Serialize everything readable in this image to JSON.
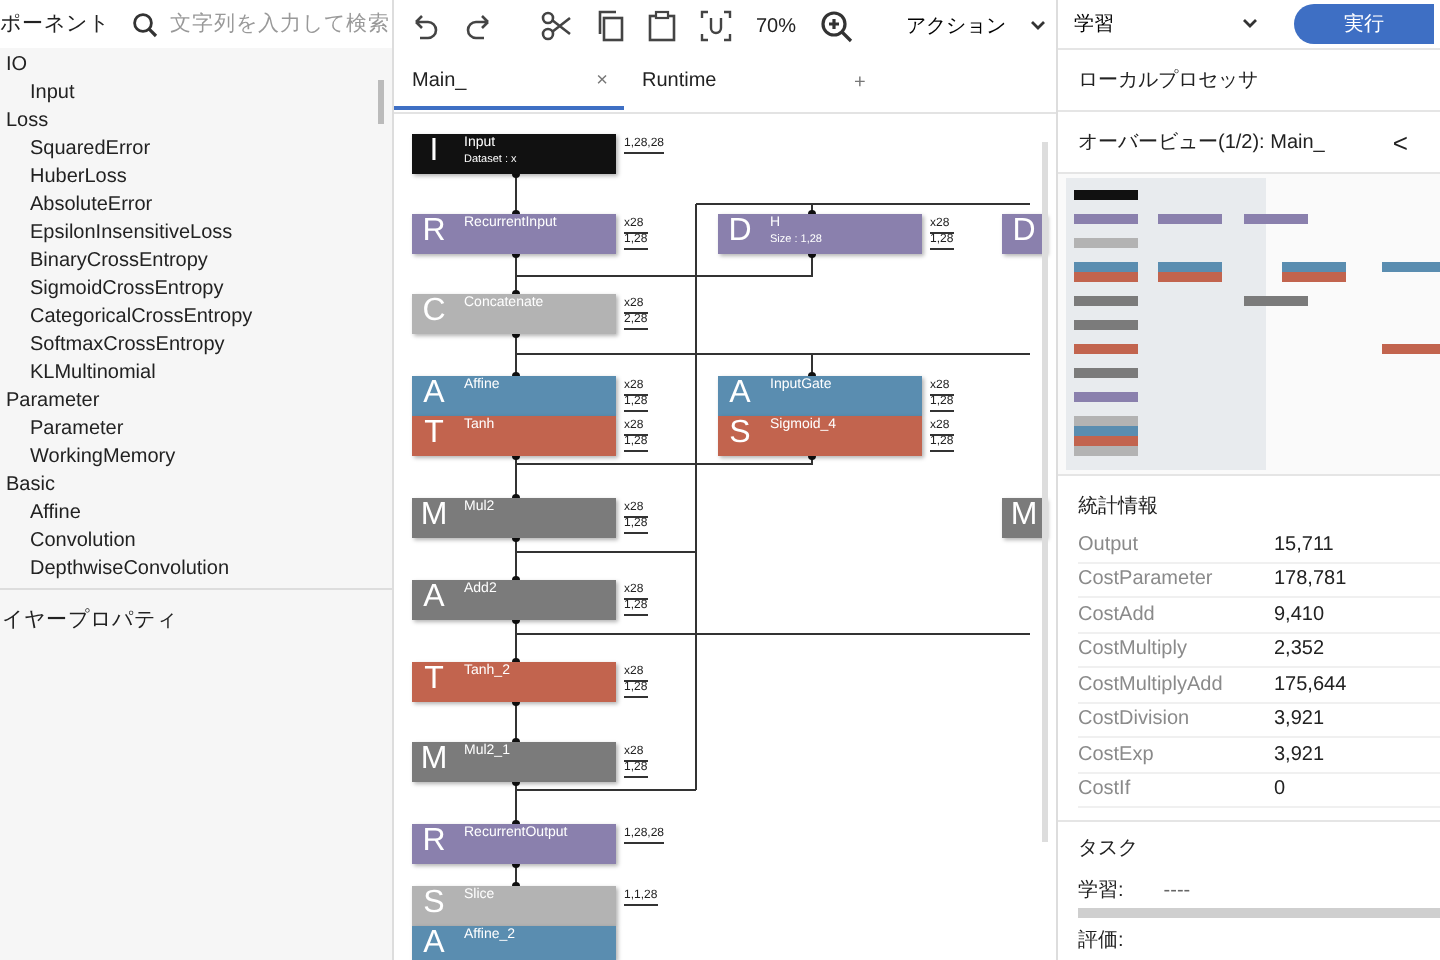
{
  "components": {
    "title": "ポーネント",
    "search_placeholder": "文字列を入力して検索",
    "groups": [
      {
        "label": "IO",
        "children": [
          {
            "label": "Input"
          }
        ]
      },
      {
        "label": "Loss",
        "children": [
          {
            "label": "SquaredError"
          },
          {
            "label": "HuberLoss"
          },
          {
            "label": "AbsoluteError"
          },
          {
            "label": "EpsilonInsensitiveLoss"
          },
          {
            "label": "BinaryCrossEntropy"
          },
          {
            "label": "SigmoidCrossEntropy"
          },
          {
            "label": "CategoricalCrossEntropy"
          },
          {
            "label": "SoftmaxCrossEntropy"
          },
          {
            "label": "KLMultinomial"
          }
        ]
      },
      {
        "label": "Parameter",
        "children": [
          {
            "label": "Parameter"
          },
          {
            "label": "WorkingMemory"
          }
        ]
      },
      {
        "label": "Basic",
        "children": [
          {
            "label": "Affine"
          },
          {
            "label": "Convolution"
          },
          {
            "label": "DepthwiseConvolution"
          }
        ]
      }
    ],
    "properties_title": "イヤープロパティ"
  },
  "toolbar": {
    "zoom": "70%",
    "action_menu": "アクション"
  },
  "tabs": [
    {
      "label": "Main_",
      "selected": true,
      "close": "×"
    },
    {
      "label": "Runtime",
      "selected": false
    }
  ],
  "add_tab": "+",
  "graph": {
    "nodes": [
      {
        "letter": "I",
        "name": "Input",
        "subtitle": "Dataset : x",
        "color": "#111111",
        "side": [
          "1,28,28"
        ]
      },
      {
        "letter": "R",
        "name": "RecurrentInput",
        "color": "#8a80ad",
        "side": [
          "x28",
          "1,28"
        ]
      },
      {
        "letter": "D",
        "name": "H",
        "subtitle": "Size : 1,28",
        "color": "#8a80ad",
        "side": [
          "x28",
          "1,28"
        ]
      },
      {
        "letter": "D",
        "color": "#8a80ad"
      },
      {
        "letter": "C",
        "name": "Concatenate",
        "color": "#b3b3b3",
        "side": [
          "x28",
          "2,28"
        ]
      },
      {
        "letter": "A",
        "name": "Affine",
        "color": "#5a8db0",
        "side": [
          "x28",
          "1,28"
        ]
      },
      {
        "letter": "T",
        "name": "Tanh",
        "color": "#c2644e",
        "side": [
          "x28",
          "1,28"
        ]
      },
      {
        "letter": "A",
        "name": "InputGate",
        "color": "#5a8db0",
        "side": [
          "x28",
          "1,28"
        ]
      },
      {
        "letter": "S",
        "name": "Sigmoid_4",
        "color": "#c2644e",
        "side": [
          "x28",
          "1,28"
        ]
      },
      {
        "letter": "M",
        "name": "Mul2",
        "color": "#7b7b7b",
        "side": [
          "x28",
          "1,28"
        ]
      },
      {
        "letter": "M",
        "color": "#7b7b7b"
      },
      {
        "letter": "A",
        "name": "Add2",
        "color": "#7b7b7b",
        "side": [
          "x28",
          "1,28"
        ]
      },
      {
        "letter": "T",
        "name": "Tanh_2",
        "color": "#c2644e",
        "side": [
          "x28",
          "1,28"
        ]
      },
      {
        "letter": "M",
        "name": "Mul2_1",
        "color": "#7b7b7b",
        "side": [
          "x28",
          "1,28"
        ]
      },
      {
        "letter": "R",
        "name": "RecurrentOutput",
        "color": "#8a80ad",
        "side": [
          "1,28,28"
        ]
      },
      {
        "letter": "S",
        "name": "Slice",
        "color": "#b3b3b3",
        "side": [
          "1,1,28"
        ]
      },
      {
        "letter": "A",
        "name": "Affine_2",
        "color": "#5a8db0"
      }
    ]
  },
  "run": {
    "mode": "学習",
    "button": "実行",
    "processor": "ローカルプロセッサ"
  },
  "overview": {
    "title": "オーバービュー(1/2): Main_",
    "collapse": "<"
  },
  "statistics": {
    "title": "統計情報",
    "rows": [
      {
        "label": "Output",
        "value": "15,711"
      },
      {
        "label": "CostParameter",
        "value": "178,781"
      },
      {
        "label": "CostAdd",
        "value": "9,410"
      },
      {
        "label": "CostMultiply",
        "value": "2,352"
      },
      {
        "label": "CostMultiplyAdd",
        "value": "175,644"
      },
      {
        "label": "CostDivision",
        "value": "3,921"
      },
      {
        "label": "CostExp",
        "value": "3,921"
      },
      {
        "label": "CostIf",
        "value": "0"
      }
    ]
  },
  "tasks": {
    "title": "タスク",
    "items": [
      {
        "label": "学習:",
        "value": "----",
        "level": 0
      },
      {
        "label": "評価:"
      }
    ]
  }
}
